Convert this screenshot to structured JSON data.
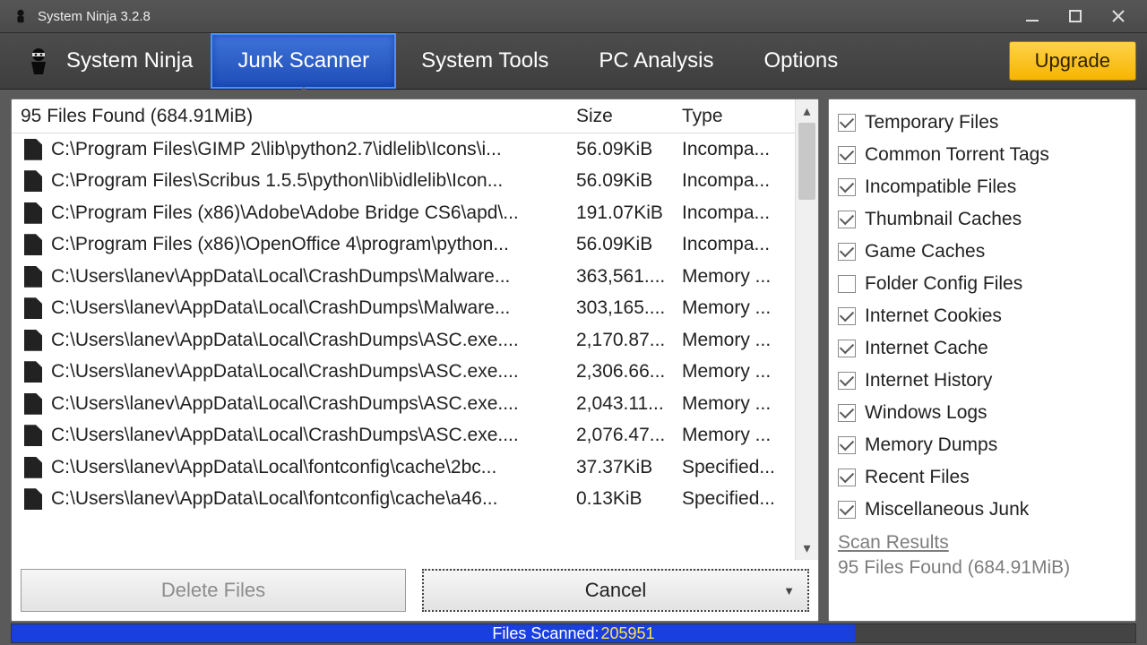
{
  "window": {
    "title": "System Ninja 3.2.8"
  },
  "brand": {
    "name": "System Ninja"
  },
  "tabs": {
    "junk_scanner": "Junk Scanner",
    "system_tools": "System Tools",
    "pc_analysis": "PC Analysis",
    "options": "Options"
  },
  "upgrade": {
    "label": "Upgrade"
  },
  "table": {
    "summary": "95 Files Found (684.91MiB)",
    "size_header": "Size",
    "type_header": "Type",
    "rows": [
      {
        "path": "C:\\Program Files\\GIMP 2\\lib\\python2.7\\idlelib\\Icons\\i...",
        "size": "56.09KiB",
        "type": "Incompa..."
      },
      {
        "path": "C:\\Program Files\\Scribus 1.5.5\\python\\lib\\idlelib\\Icon...",
        "size": "56.09KiB",
        "type": "Incompa..."
      },
      {
        "path": "C:\\Program Files (x86)\\Adobe\\Adobe Bridge CS6\\apd\\...",
        "size": "191.07KiB",
        "type": "Incompa..."
      },
      {
        "path": "C:\\Program Files (x86)\\OpenOffice 4\\program\\python...",
        "size": "56.09KiB",
        "type": "Incompa..."
      },
      {
        "path": "C:\\Users\\lanev\\AppData\\Local\\CrashDumps\\Malware...",
        "size": "363,561....",
        "type": "Memory ..."
      },
      {
        "path": "C:\\Users\\lanev\\AppData\\Local\\CrashDumps\\Malware...",
        "size": "303,165....",
        "type": "Memory ..."
      },
      {
        "path": "C:\\Users\\lanev\\AppData\\Local\\CrashDumps\\ASC.exe....",
        "size": "2,170.87...",
        "type": "Memory ..."
      },
      {
        "path": "C:\\Users\\lanev\\AppData\\Local\\CrashDumps\\ASC.exe....",
        "size": "2,306.66...",
        "type": "Memory ..."
      },
      {
        "path": "C:\\Users\\lanev\\AppData\\Local\\CrashDumps\\ASC.exe....",
        "size": "2,043.11...",
        "type": "Memory ..."
      },
      {
        "path": "C:\\Users\\lanev\\AppData\\Local\\CrashDumps\\ASC.exe....",
        "size": "2,076.47...",
        "type": "Memory ..."
      },
      {
        "path": "C:\\Users\\lanev\\AppData\\Local\\fontconfig\\cache\\2bc...",
        "size": "37.37KiB",
        "type": "Specified..."
      },
      {
        "path": "C:\\Users\\lanev\\AppData\\Local\\fontconfig\\cache\\a46...",
        "size": "0.13KiB",
        "type": "Specified..."
      }
    ]
  },
  "actions": {
    "delete": "Delete Files",
    "cancel": "Cancel"
  },
  "categories": [
    {
      "label": "Temporary Files",
      "checked": true
    },
    {
      "label": "Common Torrent Tags",
      "checked": true
    },
    {
      "label": "Incompatible Files",
      "checked": true
    },
    {
      "label": "Thumbnail Caches",
      "checked": true
    },
    {
      "label": "Game Caches",
      "checked": true
    },
    {
      "label": "Folder Config Files",
      "checked": false
    },
    {
      "label": "Internet Cookies",
      "checked": true
    },
    {
      "label": "Internet Cache",
      "checked": true
    },
    {
      "label": "Internet History",
      "checked": true
    },
    {
      "label": "Windows Logs",
      "checked": true
    },
    {
      "label": "Memory Dumps",
      "checked": true
    },
    {
      "label": "Recent Files",
      "checked": true
    },
    {
      "label": "Miscellaneous Junk",
      "checked": true
    }
  ],
  "scan_results": {
    "link_label": "Scan Results",
    "summary": "95 Files Found (684.91MiB)"
  },
  "status": {
    "label": "Files Scanned:",
    "count": "205951",
    "progress_percent": 75
  }
}
